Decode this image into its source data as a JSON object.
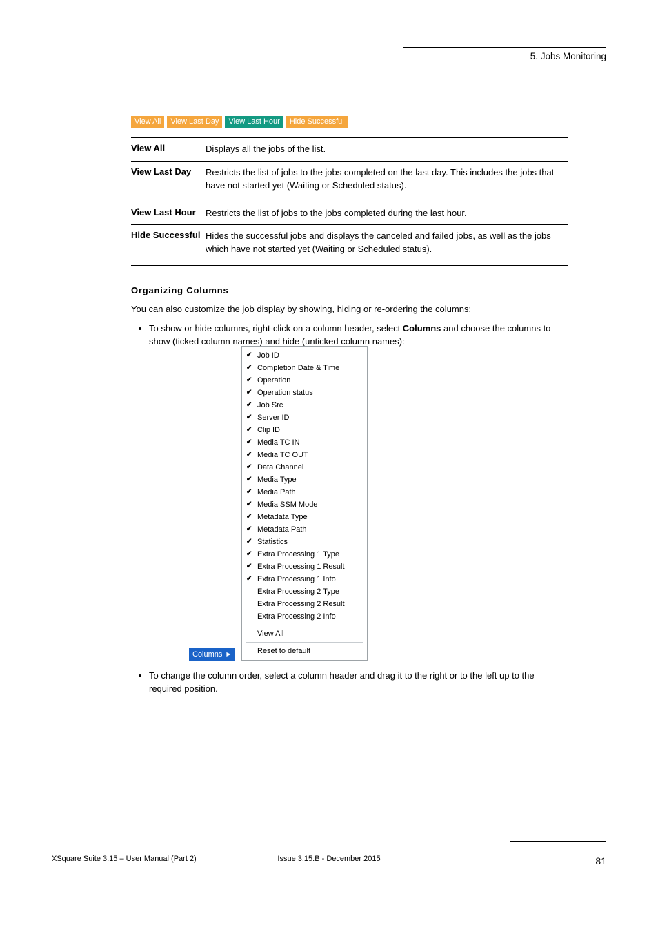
{
  "header": {
    "title": "5. Jobs Monitoring"
  },
  "footer": {
    "left": "XSquare Suite 3.15 – User Manual (Part 2)",
    "center": "Issue 3.15.B - December 2015",
    "page": "81"
  },
  "filters": {
    "view_all": "View All",
    "view_last_day": "View Last Day",
    "view_last_hour": "View Last Hour",
    "hide_successful": "Hide Successful"
  },
  "table_rows": [
    {
      "label": "View All",
      "text": "Displays all the jobs of the list."
    },
    {
      "label": "View Last Day",
      "text": "Restricts the list of jobs to the jobs completed on the last day. This includes the jobs that have not started yet (Waiting or Scheduled status)."
    },
    {
      "label": "View Last Hour",
      "text": "Restricts the list of jobs to the jobs completed during the last hour."
    },
    {
      "label": "Hide Successful",
      "text": "Hides the successful jobs and displays the canceled and failed jobs, as well as the jobs which have not started yet (Waiting or Scheduled status)."
    }
  ],
  "sections": {
    "subhead": "Organizing Columns",
    "body": "You can also customize the job display by showing, hiding or re-ordering the columns:",
    "bullet1_a": "To show or hide columns, right-click on a column header, select ",
    "bullet1_b": "Columns",
    "bullet1_c": " and choose the columns to show (ticked column names) and hide (unticked column names):",
    "bullet2": "To change the column order, select a column header and drag it to the right or to the left up to the required position."
  },
  "popup": {
    "menu_label": "Columns",
    "items": [
      {
        "label": "Job ID",
        "checked": true
      },
      {
        "label": "Completion Date & Time",
        "checked": true
      },
      {
        "label": "Operation",
        "checked": true
      },
      {
        "label": "Operation status",
        "checked": true
      },
      {
        "label": "Job Src",
        "checked": true
      },
      {
        "label": "Server ID",
        "checked": true
      },
      {
        "label": "Clip ID",
        "checked": true
      },
      {
        "label": "Media TC IN",
        "checked": true
      },
      {
        "label": "Media TC OUT",
        "checked": true
      },
      {
        "label": "Data Channel",
        "checked": true
      },
      {
        "label": "Media Type",
        "checked": true
      },
      {
        "label": "Media Path",
        "checked": true
      },
      {
        "label": "Media SSM Mode",
        "checked": true
      },
      {
        "label": "Metadata Type",
        "checked": true
      },
      {
        "label": "Metadata Path",
        "checked": true
      },
      {
        "label": "Statistics",
        "checked": true
      },
      {
        "label": "Extra Processing 1 Type",
        "checked": true
      },
      {
        "label": "Extra Processing 1 Result",
        "checked": true
      },
      {
        "label": "Extra Processing 1 Info",
        "checked": true
      },
      {
        "label": "Extra Processing 2 Type",
        "checked": false
      },
      {
        "label": "Extra Processing 2 Result",
        "checked": false
      },
      {
        "label": "Extra Processing 2 Info",
        "checked": false
      }
    ],
    "footer_items": [
      "View All",
      "Reset to default"
    ]
  }
}
